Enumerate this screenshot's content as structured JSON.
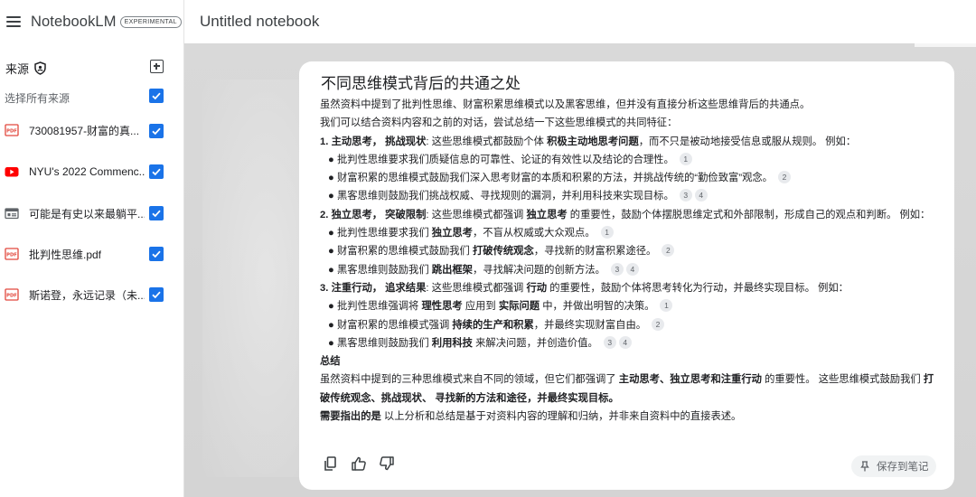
{
  "app": {
    "name": "NotebookLM",
    "badge": "EXPERIMENTAL",
    "notebook_title": "Untitled notebook"
  },
  "sidebar": {
    "sources_label": "来源",
    "select_all_label": "选择所有来源",
    "items": [
      {
        "label": "730081957-财富的真...",
        "type": "pdf",
        "checked": true
      },
      {
        "label": "NYU's 2022 Commenc...",
        "type": "youtube",
        "checked": true
      },
      {
        "label": "可能是有史以来最躺平...",
        "type": "text",
        "checked": true
      },
      {
        "label": "批判性思维.pdf",
        "type": "pdf",
        "checked": true
      },
      {
        "label": "斯诺登，永远记录（未...",
        "type": "pdf",
        "checked": true
      }
    ]
  },
  "response": {
    "title": "不同思维模式背后的共通之处",
    "intro1": "虽然资料中提到了批判性思维、财富积累思维模式以及黑客思维，但并没有直接分析这些思维背后的共通点。",
    "intro2": "我们可以结合资料内容和之前的对话，尝试总结一下这些思维模式的共同特征：",
    "s1": {
      "num": "1. ",
      "h": "主动思考， 挑战现状",
      "t1": ": 这些思维模式都鼓励个体 ",
      "b1": "积极主动地思考问题",
      "t2": "，而不只是被动地接受信息或服从规则。 例如："
    },
    "s1b1": {
      "text": "批判性思维要求我们质疑信息的可靠性、论证的有效性以及结论的合理性。",
      "cites": [
        "1"
      ]
    },
    "s1b2": {
      "text": "财富积累的思维模式鼓励我们深入思考财富的本质和积累的方法，并挑战传统的“勤俭致富”观念。",
      "cites": [
        "2"
      ]
    },
    "s1b3": {
      "text": "黑客思维则鼓励我们挑战权威、寻找规则的漏洞，并利用科技来实现目标。",
      "cites": [
        "3",
        "4"
      ]
    },
    "s2": {
      "num": "2. ",
      "h": "独立思考， 突破限制",
      "t1": ": 这些思维模式都强调 ",
      "b1": "独立思考",
      "t2": " 的重要性，鼓励个体摆脱思维定式和外部限制，形成自己的观点和判断。 例如："
    },
    "s2b1": {
      "pre": "批判性思维要求我们 ",
      "b": "独立思考",
      "post": "，不盲从权威或大众观点。",
      "cites": [
        "1"
      ]
    },
    "s2b2": {
      "pre": "财富积累的思维模式鼓励我们 ",
      "b": "打破传统观念",
      "post": "，寻找新的财富积累途径。",
      "cites": [
        "2"
      ]
    },
    "s2b3": {
      "pre": "黑客思维则鼓励我们 ",
      "b": "跳出框架",
      "post": "，寻找解决问题的创新方法。",
      "cites": [
        "3",
        "4"
      ]
    },
    "s3": {
      "num": "3. ",
      "h": "注重行动， 追求结果",
      "t1": ": 这些思维模式都强调 ",
      "b1": "行动",
      "t2": " 的重要性，鼓励个体将思考转化为行动，并最终实现目标。 例如："
    },
    "s3b1": {
      "pre": "批判性思维强调将 ",
      "b": "理性思考",
      "mid": " 应用到 ",
      "b2": "实际问题",
      "post": " 中，并做出明智的决策。",
      "cites": [
        "1"
      ]
    },
    "s3b2": {
      "pre": "财富积累的思维模式强调 ",
      "b": "持续的生产和积累",
      "post": "，并最终实现财富自由。",
      "cites": [
        "2"
      ]
    },
    "s3b3": {
      "pre": "黑客思维则鼓励我们 ",
      "b": "利用科技",
      "post": " 来解决问题，并创造价值。",
      "cites": [
        "3",
        "4"
      ]
    },
    "summary": {
      "heading": "总结",
      "t1": "虽然资料中提到的三种思维模式来自不同的领域，但它们都强调了 ",
      "b1": "主动思考、独立思考和注重行动",
      "t2": " 的重要性。 这些思维模式鼓励我们 ",
      "b2": "打破传统观念、挑战现状、 寻找新的方法和途径，并最终实现目标。"
    },
    "note": {
      "b": "需要指出的是",
      "t": " 以上分析和总结是基于对资料内容的理解和归纳，并非来自资料中的直接表述。"
    },
    "save_label": "保存到笔记"
  }
}
